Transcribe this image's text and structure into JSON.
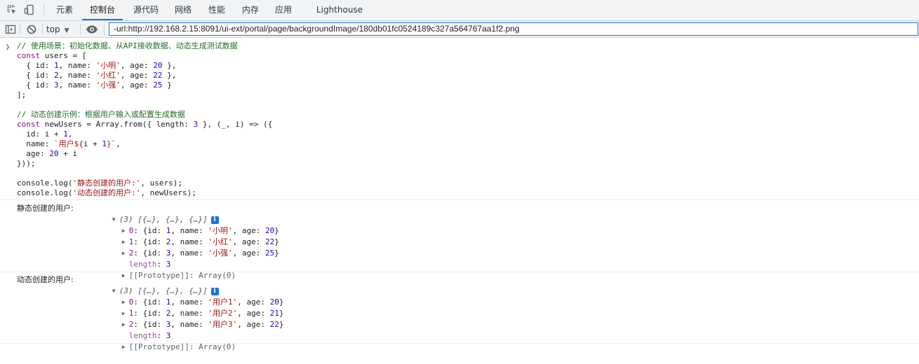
{
  "devtools": {
    "tabs": [
      {
        "label": "元素"
      },
      {
        "label": "控制台",
        "active": true
      },
      {
        "label": "源代码"
      },
      {
        "label": "网络"
      },
      {
        "label": "性能"
      },
      {
        "label": "内存"
      },
      {
        "label": "应用"
      },
      {
        "label": "Lighthouse"
      }
    ],
    "icons": {
      "inspect": "select-element-icon",
      "device": "device-toggle-icon",
      "sidebar": "show-sidebar-icon",
      "clear": "clear-console-icon",
      "eye": "live-expression-eye-icon"
    },
    "accent_color": "#1a73e8"
  },
  "toolbar": {
    "context_label": "top",
    "filter_value": "-url:http://192.168.2.15:8091/ui-ext/portal/page/backgroundImage/180db01fc0524189c327a564767aa1f2.png"
  },
  "code_lines": [
    {
      "segments": [
        {
          "t": "// 使用场景：初始化数据、从API接收数据、动态生成测试数据",
          "c": "c-comment"
        }
      ]
    },
    {
      "segments": [
        {
          "t": "const",
          "c": "c-kw"
        },
        {
          "t": " users = [",
          "c": "c-plain"
        }
      ]
    },
    {
      "segments": [
        {
          "t": "  { id: ",
          "c": "c-plain"
        },
        {
          "t": "1",
          "c": "c-num"
        },
        {
          "t": ", name: ",
          "c": "c-plain"
        },
        {
          "t": "'小明'",
          "c": "c-str"
        },
        {
          "t": ", age: ",
          "c": "c-plain"
        },
        {
          "t": "20",
          "c": "c-num"
        },
        {
          "t": " },",
          "c": "c-plain"
        }
      ]
    },
    {
      "segments": [
        {
          "t": "  { id: ",
          "c": "c-plain"
        },
        {
          "t": "2",
          "c": "c-num"
        },
        {
          "t": ", name: ",
          "c": "c-plain"
        },
        {
          "t": "'小红'",
          "c": "c-str"
        },
        {
          "t": ", age: ",
          "c": "c-plain"
        },
        {
          "t": "22",
          "c": "c-num"
        },
        {
          "t": " },",
          "c": "c-plain"
        }
      ]
    },
    {
      "segments": [
        {
          "t": "  { id: ",
          "c": "c-plain"
        },
        {
          "t": "3",
          "c": "c-num"
        },
        {
          "t": ", name: ",
          "c": "c-plain"
        },
        {
          "t": "'小强'",
          "c": "c-str"
        },
        {
          "t": ", age: ",
          "c": "c-plain"
        },
        {
          "t": "25",
          "c": "c-num"
        },
        {
          "t": " }",
          "c": "c-plain"
        }
      ]
    },
    {
      "segments": [
        {
          "t": "];",
          "c": "c-plain"
        }
      ]
    },
    {
      "segments": []
    },
    {
      "segments": [
        {
          "t": "// 动态创建示例：根据用户输入或配置生成数据",
          "c": "c-comment"
        }
      ]
    },
    {
      "segments": [
        {
          "t": "const",
          "c": "c-kw"
        },
        {
          "t": " newUsers = Array.from({ length: ",
          "c": "c-plain"
        },
        {
          "t": "3",
          "c": "c-num"
        },
        {
          "t": " }, (_, i) => ({",
          "c": "c-plain"
        }
      ]
    },
    {
      "segments": [
        {
          "t": "  id: i + ",
          "c": "c-plain"
        },
        {
          "t": "1",
          "c": "c-num"
        },
        {
          "t": ",",
          "c": "c-plain"
        }
      ]
    },
    {
      "segments": [
        {
          "t": "  name: ",
          "c": "c-plain"
        },
        {
          "t": "`用户${",
          "c": "c-str"
        },
        {
          "t": "i + ",
          "c": "c-plain"
        },
        {
          "t": "1",
          "c": "c-num"
        },
        {
          "t": "}`",
          "c": "c-str"
        },
        {
          "t": ",",
          "c": "c-plain"
        }
      ]
    },
    {
      "segments": [
        {
          "t": "  age: ",
          "c": "c-plain"
        },
        {
          "t": "20",
          "c": "c-num"
        },
        {
          "t": " + i",
          "c": "c-plain"
        }
      ]
    },
    {
      "segments": [
        {
          "t": "}));",
          "c": "c-plain"
        }
      ]
    },
    {
      "segments": []
    },
    {
      "segments": [
        {
          "t": "console.log(",
          "c": "c-plain"
        },
        {
          "t": "'静态创建的用户:'",
          "c": "c-str"
        },
        {
          "t": ", users);",
          "c": "c-plain"
        }
      ]
    },
    {
      "segments": [
        {
          "t": "console.log(",
          "c": "c-plain"
        },
        {
          "t": "'动态创建的用户:'",
          "c": "c-str"
        },
        {
          "t": ", newUsers);",
          "c": "c-plain"
        }
      ]
    }
  ],
  "logs": [
    {
      "label": "静态创建的用户:",
      "summary": "(3) [{…}, {…}, {…}]",
      "badge": "i",
      "items": [
        {
          "index": "0",
          "id": "1",
          "name": "'小明'",
          "age": "20"
        },
        {
          "index": "1",
          "id": "2",
          "name": "'小红'",
          "age": "22"
        },
        {
          "index": "2",
          "id": "3",
          "name": "'小强'",
          "age": "25"
        }
      ],
      "length_key": "length",
      "length_value": "3",
      "prototype": "[[Prototype]]: Array(0)"
    },
    {
      "label": "动态创建的用户:",
      "summary": "(3) [{…}, {…}, {…}]",
      "badge": "i",
      "items": [
        {
          "index": "0",
          "id": "1",
          "name": "'用户1'",
          "age": "20"
        },
        {
          "index": "1",
          "id": "2",
          "name": "'用户2'",
          "age": "21"
        },
        {
          "index": "2",
          "id": "3",
          "name": "'用户3'",
          "age": "22"
        }
      ],
      "length_key": "length",
      "length_value": "3",
      "prototype": "[[Prototype]]: Array(0)"
    }
  ]
}
